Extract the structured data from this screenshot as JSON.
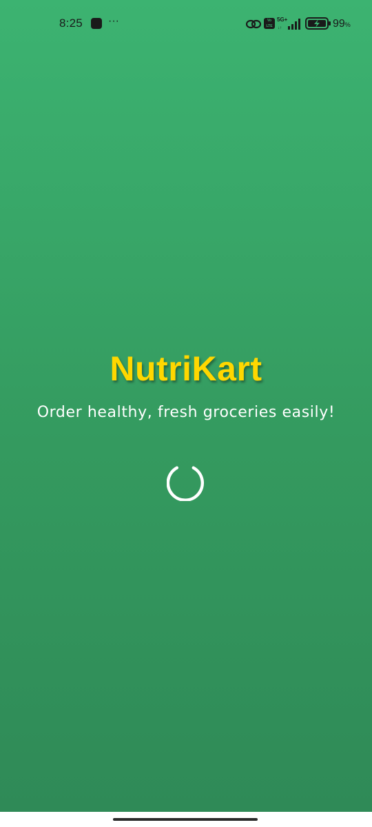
{
  "status_bar": {
    "time": "8:25",
    "more": "···",
    "network": "5G+",
    "volte": "Vo LTE",
    "battery_percent": "99",
    "percent_sign": "%"
  },
  "splash": {
    "app_name": "NutriKart",
    "tagline": "Order healthy, fresh groceries easily!",
    "loading": true
  },
  "colors": {
    "background_top": "#3cb371",
    "background_bottom": "#2f8a57",
    "title": "#ffd700",
    "tagline": "#ffffff",
    "spinner": "#ffffff"
  },
  "icons": {
    "status": [
      "app-notification-icon",
      "more-icon",
      "link-icon",
      "volte-icon",
      "signal-icon",
      "battery-charging-icon"
    ],
    "center": [
      "loading-spinner-icon"
    ]
  }
}
